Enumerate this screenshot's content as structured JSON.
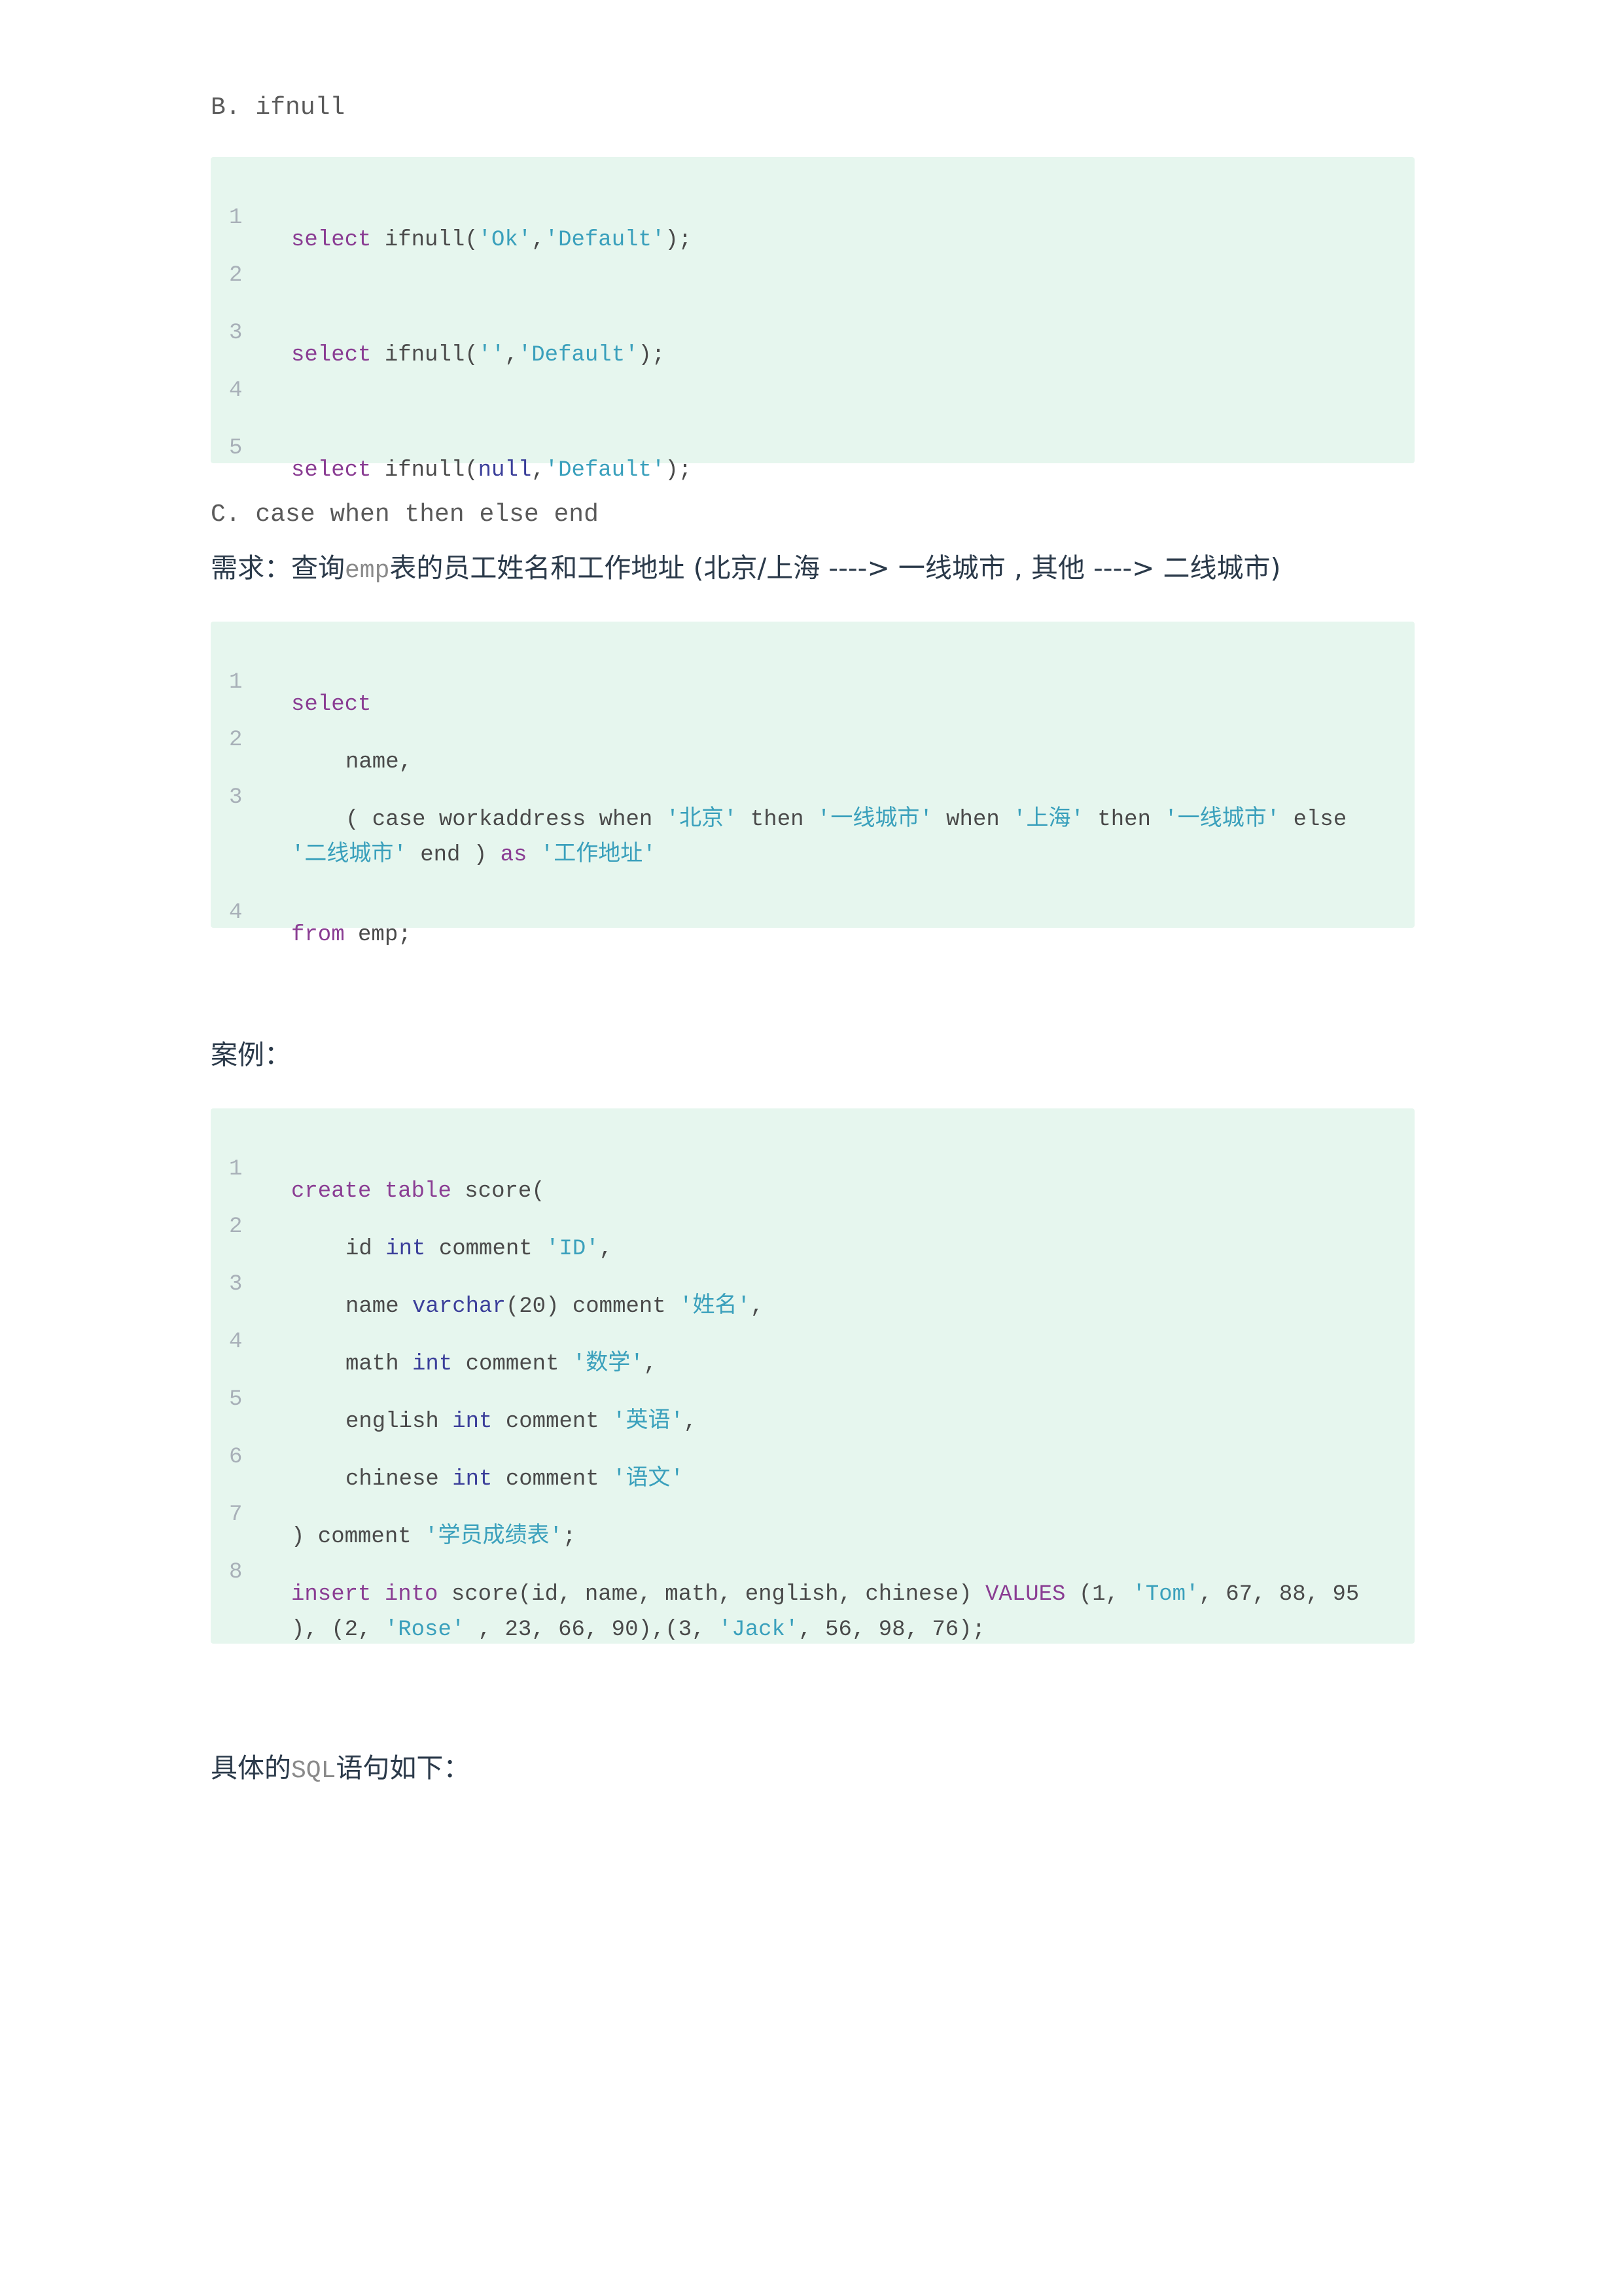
{
  "headings": {
    "b": "B. ifnull",
    "c": "C. case when then else end"
  },
  "requirement": {
    "prefix": "需求：查询",
    "code": "emp",
    "suffix": "表的员工姓名和工作地址 (北京/上海 ----> 一线城市 , 其他 ----> 二线城市)"
  },
  "case_label": "案例：",
  "sql_label": {
    "prefix": "具体的",
    "code": "SQL",
    "suffix": "语句如下："
  },
  "ifnull_block": {
    "line_numbers": [
      "1",
      "2",
      "3",
      "4",
      "5"
    ],
    "line1": {
      "kw": "select",
      "fn": " ifnull(",
      "s1": "'Ok'",
      "comma": ",",
      "s2": "'Default'",
      "end": ");"
    },
    "line3": {
      "kw": "select",
      "fn": " ifnull(",
      "s1": "''",
      "comma": ",",
      "s2": "'Default'",
      "end": ");"
    },
    "line5": {
      "kw": "select",
      "fn": " ifnull(",
      "null": "null",
      "comma": ",",
      "s2": "'Default'",
      "end": ");"
    }
  },
  "case_block": {
    "line_numbers": [
      "1",
      "2",
      "3",
      "4"
    ],
    "line1": "select",
    "line2": "name,",
    "line3": {
      "a": "( case workaddress when ",
      "s1": "'北京'",
      "b": " then ",
      "s2": "'一线城市'",
      "c": " when ",
      "s3": "'上海'",
      "d": " then ",
      "s4": "'一线城市'",
      "e": " else"
    },
    "line3_cont": {
      "s5": "'二线城市'",
      "a": " end ) ",
      "as": "as",
      "b": " ",
      "s6": "'工作地址'"
    },
    "line4": {
      "kw": "from",
      "rest": " emp;"
    }
  },
  "score_block": {
    "line_numbers": [
      "1",
      "2",
      "3",
      "4",
      "5",
      "6",
      "7",
      "8"
    ],
    "line1": {
      "kw1": "create",
      "sp": " ",
      "kw2": "table",
      "rest": " score("
    },
    "line2": {
      "a": "id ",
      "type": "int",
      "b": " comment ",
      "s": "'ID'",
      "end": ","
    },
    "line3": {
      "a": "name ",
      "type": "varchar",
      "b": "(20) comment ",
      "s": "'姓名'",
      "end": ","
    },
    "line4": {
      "a": "math ",
      "type": "int",
      "b": " comment ",
      "s": "'数学'",
      "end": ","
    },
    "line5": {
      "a": "english ",
      "type": "int",
      "b": " comment ",
      "s": "'英语'",
      "end": ","
    },
    "line6": {
      "a": "chinese ",
      "type": "int",
      "b": " comment ",
      "s": "'语文'"
    },
    "line7": {
      "a": ") comment ",
      "s": "'学员成绩表'",
      "end": ";"
    },
    "line8": {
      "kw1": "insert",
      "sp": " ",
      "kw2": "into",
      "a": " score(id, name, math, english, chinese) ",
      "values": "VALUES",
      "b": " (1, ",
      "s1": "'Tom'",
      "c": ", 67, 88, 95"
    },
    "line8_cont": {
      "a": "), (2, ",
      "s2": "'Rose'",
      "b": " , 23, 66, 90),(3, ",
      "s3": "'Jack'",
      "c": ", 56, 98, 76);"
    }
  }
}
